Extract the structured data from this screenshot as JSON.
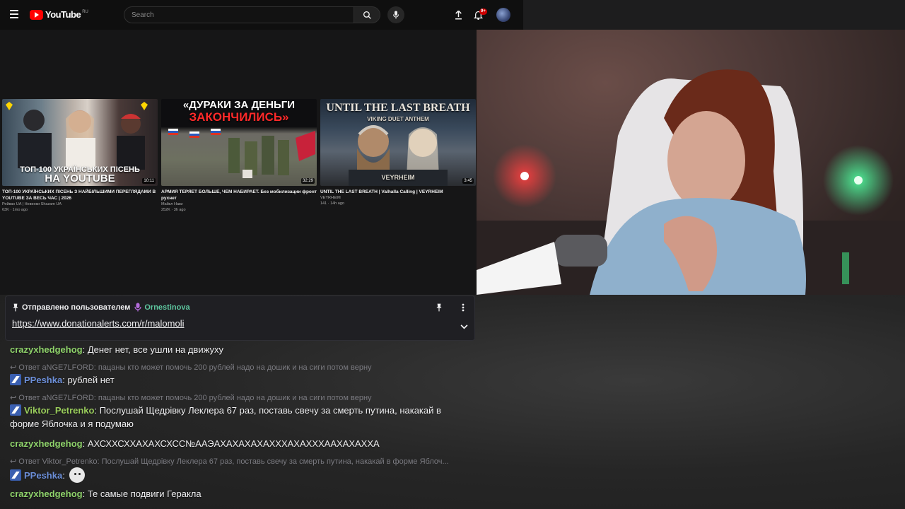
{
  "youtube": {
    "logo_text": "YouTube",
    "region": "RU",
    "search_placeholder": "Search",
    "notification_count": "9+",
    "videos": [
      {
        "thumb_text_line1": "ТОП-100 УКРАЇНСЬКИХ ПІСЕНЬ",
        "thumb_text_line2": "НА YOUTUBE",
        "duration": "10:11",
        "title": "ТОП-100 УКРАЇНСЬКИХ ПІСЕНЬ З НАЙБІЛЬШИМИ ПЕРЕГЛЯДАМИ В YOUTUBE ЗА ВЕСЬ ЧАС | 2026",
        "channel": "Рейвах UA | Новинки Shazam UA",
        "meta": "63K · 1mo ago"
      },
      {
        "thumb_text_line1": "«ДУРАКИ ЗА ДЕНЬГИ",
        "thumb_text_line2": "ЗАКОНЧИЛИСЬ»",
        "duration": "32:29",
        "title": "АРМИЯ ТЕРЯЕТ БОЛЬШЕ, ЧЕМ НАБИРАЕТ. Без мобилизации фронт рухнет",
        "channel": "Майкл Наки",
        "meta": "252K · 3h ago"
      },
      {
        "thumb_text_line1": "UNTIL THE LAST BREATH",
        "thumb_text_line2": "VIKING DUET ANTHEM",
        "thumb_text_line3": "VEYRHEIM",
        "duration": "3:45",
        "title": "UNTIL THE LAST BREATH | Valhalla Calling | VEYRHEIM",
        "channel": "VEYRHEIM",
        "meta": "141 · 14h ago"
      }
    ]
  },
  "pinned": {
    "prefix": "Отправлено пользователем",
    "user": "Ornestinova",
    "link": "https://www.donationalerts.com/r/malomoli"
  },
  "chat": [
    {
      "user": "crazyxhedgehog",
      "text": "Денег нет, все ушли на движуху"
    },
    {
      "reply": "Ответ aNGE7LFORD: пацаны кто может помочь 200 рублей надо на дошик и на сиги потом верну"
    },
    {
      "user": "PPeshka",
      "text": "рублей нет"
    },
    {
      "reply": "Ответ aNGE7LFORD: пацаны кто может помочь 200 рублей надо на дошик и на сиги потом верну"
    },
    {
      "user": "Viktor_Petrenko",
      "text": "Послушай Щедрівку Леклера 67 раз, поставь свечу за смерть путина, накакай в форме Яблочка и я подумаю"
    },
    {
      "user": "crazyxhedgehog",
      "text": "АХСХХСХХАХАХСХСС№ААЭАХАХАХАХАХХХАХАХХХААХАХАХХА"
    },
    {
      "reply": "Ответ Viktor_Petrenko: Послушай Щедрівку Леклера 67 раз, поставь свечу за смерть путина, накакай в форме Яблоч..."
    },
    {
      "user": "PPeshka",
      "text": ""
    },
    {
      "user": "crazyxhedgehog",
      "text": "Те самые подвиги Геракла"
    }
  ]
}
